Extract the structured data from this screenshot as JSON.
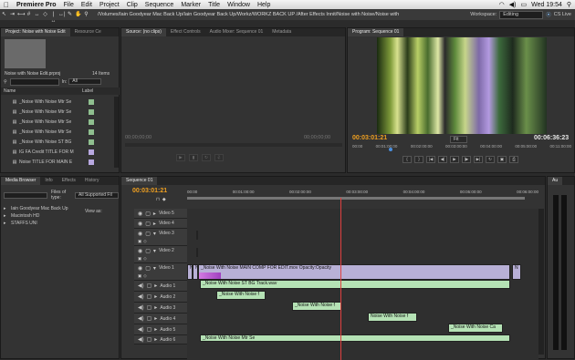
{
  "menubar": {
    "app_name": "Premiere Pro",
    "menus": [
      "File",
      "Edit",
      "Project",
      "Clip",
      "Sequence",
      "Marker",
      "Title",
      "Window",
      "Help"
    ],
    "clock": "Wed 19:54"
  },
  "titlebar": {
    "path": "/Volumes/Iain Goodyear Mac Back Up/Iain Goodyear Back Up/Workz/WORKZ BACK UP /After Effects Innit/Noise with Noise/Noise with Noise Edit.prproj *",
    "workspace_label": "Workspace:",
    "workspace_value": "Editing",
    "cs_live": "CS Live"
  },
  "project_panel": {
    "tabs": [
      "Project: Noise with Noise Edit",
      "Resource Ce"
    ],
    "project_name": "Noise with Noise Edit.prproj",
    "item_count": "14 Items",
    "in_label": "In:",
    "in_value": "All",
    "col_name": "Name",
    "col_label": "Label",
    "items": [
      {
        "name": "_Noise With Noise Mtr Se",
        "color": "#8fbf8f"
      },
      {
        "name": "_Noise With Noise Mtr Se",
        "color": "#8fbf8f"
      },
      {
        "name": "_Noise With Noise Mtr Se",
        "color": "#8fbf8f"
      },
      {
        "name": "_Noise With Noise Mtr Se",
        "color": "#8fbf8f"
      },
      {
        "name": "_Noise With Noise ST BG",
        "color": "#8fbf8f"
      },
      {
        "name": "IG FA Credit TITLE FOR M",
        "color": "#b8a8e0"
      },
      {
        "name": "Noise TITLE FOR MAIN E",
        "color": "#b8a8e0"
      }
    ]
  },
  "source_panel": {
    "tabs": [
      "Source: (no clips)",
      "Effect Controls",
      "Audio Mixer: Sequence 01",
      "Metadata"
    ],
    "tc_left": "00;00;00;00",
    "tc_right": "00;00;00;00"
  },
  "program_panel": {
    "tab": "Program: Sequence 01",
    "tc_current": "00:03:01:21",
    "fit": "Fit",
    "tc_duration": "00:06:36:23",
    "ruler": [
      "00:00",
      "00:01:00:00",
      "00:02:00:00",
      "00:03:00:00",
      "00:04:00:00",
      "00:05:00:00",
      "00:11:00:00"
    ]
  },
  "media_panel": {
    "tabs": [
      "Media Browser",
      "Info",
      "Effects",
      "History"
    ],
    "files_type_label": "Files of type:",
    "files_type_value": "All Supported Fil",
    "view_as_label": "View as:",
    "drives": [
      "Iain Goodyear Mac Back Up",
      "Macintosh HD",
      "STAFFS UNI"
    ]
  },
  "timeline": {
    "tab": "Sequence 01",
    "tc": "00:03:01:21",
    "ruler": [
      "00:00",
      "00:01:00:00",
      "00:02:00:00",
      "00:03:00:00",
      "00:04:00:00",
      "00:05:00:00",
      "00:06:00:00"
    ],
    "tracks": [
      {
        "name": "Video 5",
        "type": "video"
      },
      {
        "name": "Video 4",
        "type": "video"
      },
      {
        "name": "Video 3",
        "type": "video"
      },
      {
        "name": "Video 2",
        "type": "video"
      },
      {
        "name": "Video 1",
        "type": "video"
      },
      {
        "name": "Audio 1",
        "type": "audio"
      },
      {
        "name": "Audio 2",
        "type": "audio"
      },
      {
        "name": "Audio 3",
        "type": "audio"
      },
      {
        "name": "Audio 4",
        "type": "audio"
      },
      {
        "name": "Audio 5",
        "type": "audio"
      },
      {
        "name": "Audio 6",
        "type": "audio"
      }
    ],
    "clips": {
      "video1_main": "_Noise With Noise MAIN COMP FOR EDIT.mov  Opacity:Opacity",
      "video1_left_a": "N",
      "video1_left_b": "N",
      "video1_end": "N",
      "audio1": "_Noise With Noise ST BG Track.wav",
      "audio2": "_Noise With Noise f",
      "audio3": "_Noise With Noise f",
      "audio4": "Noise With Noise f",
      "audio5": "_Noise With Noise Ca",
      "audio6": "_Noise With Noise Mtr Se"
    }
  },
  "audio_meters": {
    "tab": "Au"
  }
}
